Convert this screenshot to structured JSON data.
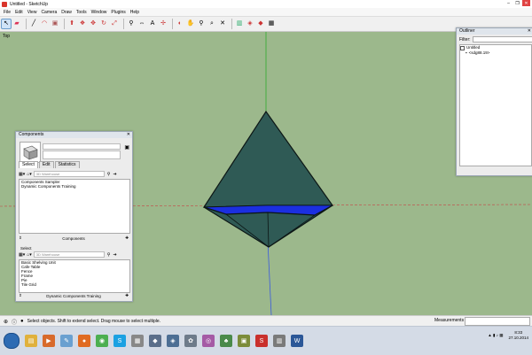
{
  "window": {
    "title": "Untitled - SketchUp",
    "controls": [
      "–",
      "❐",
      "✕"
    ]
  },
  "menu": [
    "File",
    "Edit",
    "View",
    "Camera",
    "Draw",
    "Tools",
    "Window",
    "Plugins",
    "Help"
  ],
  "viewport": {
    "label": "Top",
    "background": "#9cb88c",
    "model_fill": "#2f5a55",
    "highlight_fill": "#1b2fe0"
  },
  "components": {
    "title": "Components",
    "tabs": [
      "Select",
      "Edit",
      "Statistics"
    ],
    "search_placeholder": "3D Warehouse",
    "list1": [
      "Components Sampler",
      "Dynamic Components Training"
    ],
    "footer1": "Components",
    "section2_label": "Select",
    "search2_placeholder": "3D Warehouse",
    "list2": [
      "Basic Shelving Unit",
      "Cafe Table",
      "Fence",
      "Frame",
      "Pie",
      "Tile Grid"
    ],
    "footer2": "Dynamic Components Training"
  },
  "outliner": {
    "title": "Outliner",
    "filter_label": "Filter:",
    "root": "Untitled",
    "child": "<sdg88.19>"
  },
  "status": {
    "message": "Select objects. Shift to extend select. Drag mouse to select multiple.",
    "measurements_label": "Measurements"
  },
  "taskbar": {
    "apps": [
      {
        "name": "explorer",
        "color": "#e0b13c",
        "glyph": "▤"
      },
      {
        "name": "media",
        "color": "#d86a2b",
        "glyph": "▶"
      },
      {
        "name": "paint",
        "color": "#6aa0d0",
        "glyph": "✎"
      },
      {
        "name": "firefox",
        "color": "#e06b22",
        "glyph": "●"
      },
      {
        "name": "chrome",
        "color": "#4caf50",
        "glyph": "◉"
      },
      {
        "name": "skype",
        "color": "#1ba1e2",
        "glyph": "S"
      },
      {
        "name": "tool",
        "color": "#888888",
        "glyph": "▦"
      },
      {
        "name": "app",
        "color": "#5a6e8a",
        "glyph": "◆"
      },
      {
        "name": "app",
        "color": "#4d6f94",
        "glyph": "◈"
      },
      {
        "name": "app",
        "color": "#6e7b8a",
        "glyph": "✿"
      },
      {
        "name": "app",
        "color": "#a55aa5",
        "glyph": "◎"
      },
      {
        "name": "app",
        "color": "#4a8a4a",
        "glyph": "♣"
      },
      {
        "name": "app",
        "color": "#7c8c3a",
        "glyph": "▣"
      },
      {
        "name": "sketchup",
        "color": "#c9302c",
        "glyph": "S"
      },
      {
        "name": "app",
        "color": "#7a7a7a",
        "glyph": "▥"
      },
      {
        "name": "word",
        "color": "#2b5797",
        "glyph": "W"
      }
    ],
    "time": "8:33",
    "date": "27.10.2014"
  }
}
